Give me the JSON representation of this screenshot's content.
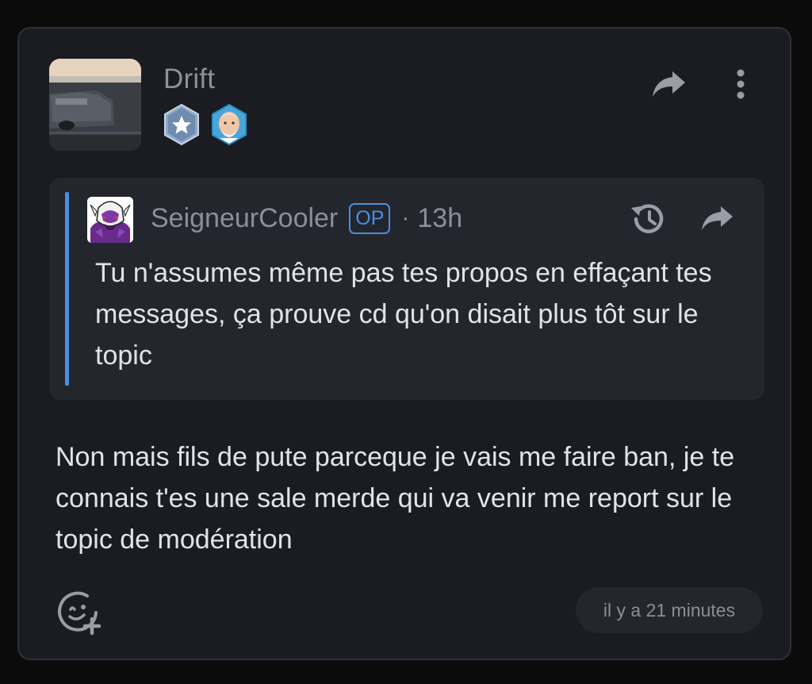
{
  "post": {
    "author": "Drift",
    "avatar_icon": "car-photo-avatar",
    "badges": [
      {
        "icon": "star-hexagon-badge-icon"
      },
      {
        "icon": "harold-portrait-badge-icon"
      }
    ],
    "actions": {
      "share_icon": "share-arrow-icon",
      "more_icon": "vertical-dots-icon"
    },
    "quote": {
      "author": "SeigneurCooler",
      "op_label": "OP",
      "separator": "·",
      "time": "13h",
      "text": "Tu n'assumes même pas tes propos en effaçant tes messages, ça prouve cd qu'on disait plus tôt sur le topic",
      "history_icon": "history-icon",
      "share_icon": "share-arrow-icon"
    },
    "body": "Non mais fils de pute parceque je vais me faire ban, je te connais t'es une sale merde qui va venir me report sur le topic de modération",
    "footer": {
      "react_icon": "add-reaction-icon",
      "timestamp": "il y a 21 minutes"
    }
  },
  "colors": {
    "background": "#0b0b0c",
    "card": "#1b1c21",
    "quote_bg": "#24262d",
    "accent": "#4a8fe0",
    "muted_text": "#8c8f99",
    "text": "#e2e3e8"
  }
}
